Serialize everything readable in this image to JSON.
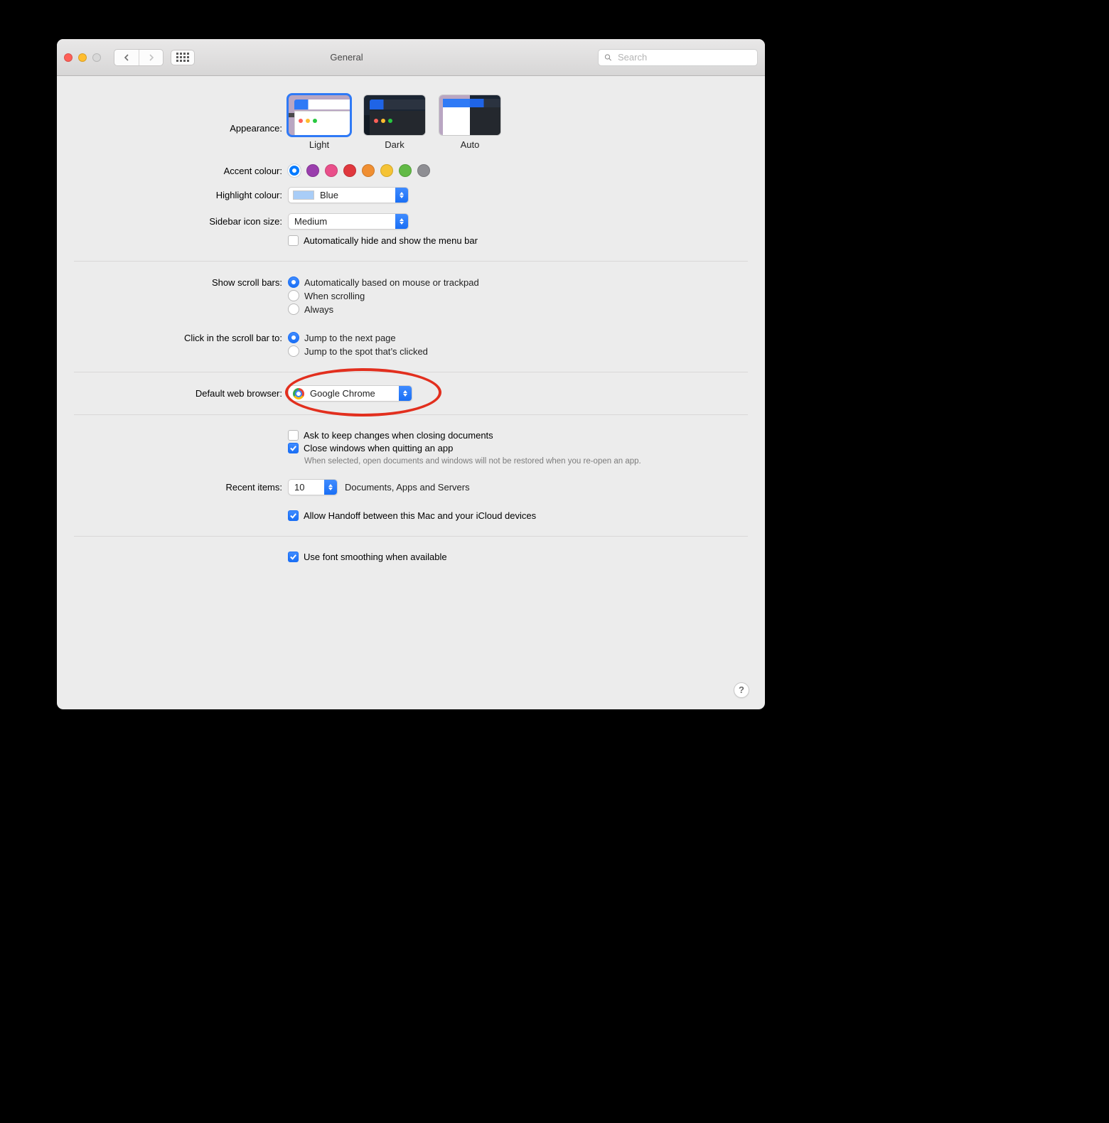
{
  "titlebar": {
    "title": "General",
    "search_placeholder": "Search"
  },
  "appearance": {
    "label": "Appearance:",
    "options": [
      "Light",
      "Dark",
      "Auto"
    ],
    "selected": "Light"
  },
  "accent": {
    "label": "Accent colour:",
    "colors": [
      "#007aff",
      "#9a3ead",
      "#e94f8a",
      "#e0383e",
      "#f08f32",
      "#f5c335",
      "#62ba46",
      "#8e8e93"
    ],
    "selected_index": 0
  },
  "highlight": {
    "label": "Highlight colour:",
    "value": "Blue",
    "swatch": "#a9cdf7"
  },
  "sidebar_size": {
    "label": "Sidebar icon size:",
    "value": "Medium"
  },
  "auto_hide_menubar": {
    "label": "Automatically hide and show the menu bar",
    "checked": false
  },
  "scroll_bars": {
    "label": "Show scroll bars:",
    "options": [
      "Automatically based on mouse or trackpad",
      "When scrolling",
      "Always"
    ],
    "selected_index": 0
  },
  "scroll_click": {
    "label": "Click in the scroll bar to:",
    "options": [
      "Jump to the next page",
      "Jump to the spot that’s clicked"
    ],
    "selected_index": 0
  },
  "default_browser": {
    "label": "Default web browser:",
    "value": "Google Chrome"
  },
  "ask_keep_changes": {
    "label": "Ask to keep changes when closing documents",
    "checked": false
  },
  "close_windows": {
    "label": "Close windows when quitting an app",
    "checked": true,
    "note": "When selected, open documents and windows will not be restored when you re-open an app."
  },
  "recent_items": {
    "label": "Recent items:",
    "value": "10",
    "suffix": "Documents, Apps and Servers"
  },
  "handoff": {
    "label": "Allow Handoff between this Mac and your iCloud devices",
    "checked": true
  },
  "font_smoothing": {
    "label": "Use font smoothing when available",
    "checked": true
  }
}
